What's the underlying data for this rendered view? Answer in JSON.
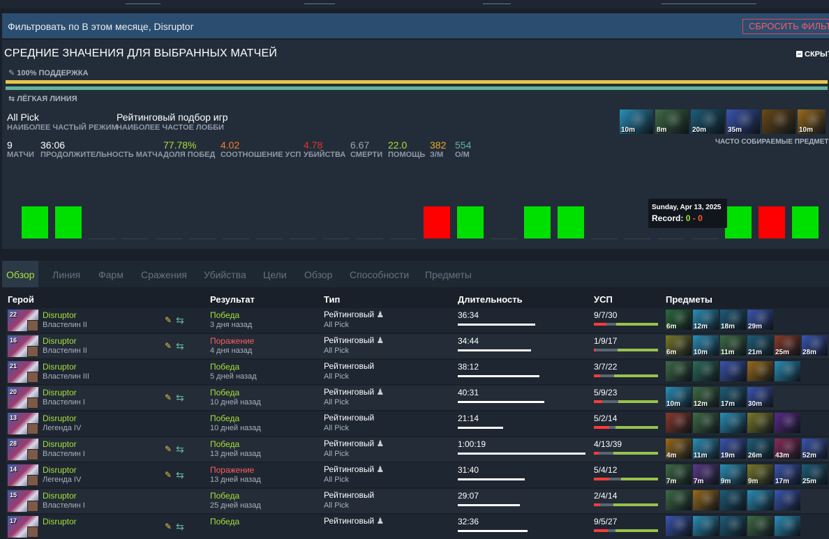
{
  "filter": {
    "text": "Фильтровать по В этом месяце, Disruptor",
    "reset_label": "СБРОСИТЬ ФИЛЬТР"
  },
  "averages": {
    "title": "СРЕДНИЕ ЗНАЧЕНИЯ ДЛЯ ВЫБРАННЫХ МАТЧЕЙ",
    "hide_label": "СКРЫТЬ",
    "support_label": "100% ПОДДЕРЖКА",
    "lane_label": "ЛЁГКАЯ ЛИНИЯ",
    "mode_value": "All Pick",
    "mode_label": "НАИБОЛЕЕ ЧАСТЫЙ РЕЖИМ",
    "lobby_value": "Рейтинговый подбор игр",
    "lobby_label": "НАИБОЛЕЕ ЧАСТОЕ ЛОББИ",
    "stats": [
      {
        "value": "9",
        "label": "МАТЧИ",
        "color": "#ffffff"
      },
      {
        "value": "36:06",
        "label": "ПРОДОЛЖИТЕЛЬНОСТЬ МАТЧА",
        "color": "#ffffff"
      },
      {
        "value": "77.78%",
        "label": "ДОЛЯ ПОБЕД",
        "color": "#a6e13b"
      },
      {
        "value": "4.02",
        "label": "СООТНОШЕНИЕ УСП",
        "color": "#ff7a2f"
      },
      {
        "value": "4.78",
        "label": "УБИЙСТВА",
        "color": "#e5312f"
      },
      {
        "value": "6.67",
        "label": "СМЕРТИ",
        "color": "#9aa3ad"
      },
      {
        "value": "22.0",
        "label": "ПОМОЩЬ",
        "color": "#a6e13b"
      },
      {
        "value": "382",
        "label": "З/М",
        "color": "#f0a828"
      },
      {
        "value": "554",
        "label": "О/М",
        "color": "#63b49a"
      }
    ],
    "fav_items": [
      {
        "time": "10m",
        "icon": "bottle-icon",
        "color": "#2a8fb8"
      },
      {
        "time": "8m",
        "icon": "wand-icon",
        "color": "#3f6b45"
      },
      {
        "time": "20m",
        "icon": "blink-icon",
        "color": "#1f5d79"
      },
      {
        "time": "35m",
        "icon": "scepter-icon",
        "color": "#3b55b0"
      },
      {
        "time": "",
        "icon": "box-icon",
        "color": "#6b4a18"
      },
      {
        "time": "10m",
        "icon": "staff-icon",
        "color": "#9a6a1c"
      }
    ],
    "fav_label": "ЧАСТО СОБИРАЕМЫЕ ПРЕДМЕТЫ",
    "streak": [
      "win",
      "win",
      "none",
      "none",
      "none",
      "none",
      "none",
      "none",
      "none",
      "none",
      "none",
      "none",
      "loss",
      "win",
      "none",
      "win",
      "win",
      "none",
      "none",
      "none",
      "none",
      "win",
      "loss",
      "win"
    ],
    "colors": {
      "win": "#00e000",
      "loss": "#ff0000"
    },
    "tooltip": {
      "date": "Sunday, Apr 13, 2025",
      "label": "Record:",
      "wins": "0",
      "sep": "-",
      "losses": "0"
    }
  },
  "tabs": [
    "Обзор",
    "Линия",
    "Фарм",
    "Сражения",
    "Убийства",
    "Цели",
    "Обзор",
    "Способности",
    "Предметы"
  ],
  "table": {
    "headers": {
      "hero": "Герой",
      "result": "Результат",
      "type": "Тип",
      "duration": "Длительность",
      "kda": "УСП",
      "items": "Предметы"
    },
    "rows": [
      {
        "level": "22",
        "hero": "Disruptor",
        "rank": "Властелин II",
        "icons": true,
        "result": "Победа",
        "win": true,
        "ago": "3 дня назад",
        "type": "Рейтинговый",
        "party": true,
        "mode": "All Pick",
        "duration": "36:34",
        "dur_frac": 0.6,
        "kda": "9/7/30",
        "k": 9,
        "d": 7,
        "a": 30,
        "items": [
          {
            "t": "6m",
            "c": "#2b6b3a"
          },
          {
            "t": "12m",
            "c": "#2a8fb8"
          },
          {
            "t": "18m",
            "c": "#1f5d79"
          },
          {
            "t": "29m",
            "c": "#3b55b0"
          }
        ]
      },
      {
        "level": "16",
        "hero": "Disruptor",
        "rank": "Властелин II",
        "icons": true,
        "result": "Поражение",
        "win": false,
        "ago": "4 дня назад",
        "type": "Рейтинговый",
        "party": true,
        "mode": "All Pick",
        "duration": "34:44",
        "dur_frac": 0.57,
        "kda": "1/9/17",
        "k": 1,
        "d": 9,
        "a": 17,
        "items": [
          {
            "t": "6m",
            "c": "#7a7a2a"
          },
          {
            "t": "10m",
            "c": "#2a8fb8"
          },
          {
            "t": "11m",
            "c": "#3f6b45"
          },
          {
            "t": "21m",
            "c": "#1f5d79"
          },
          {
            "t": "25m",
            "c": "#8a3a2a"
          },
          {
            "t": "28m",
            "c": "#3b55b0"
          }
        ]
      },
      {
        "level": "21",
        "hero": "Disruptor",
        "rank": "Властелин III",
        "icons": false,
        "result": "Победа",
        "win": true,
        "ago": "5 дней назад",
        "type": "Рейтинговый",
        "party": false,
        "mode": "All Pick",
        "duration": "38:12",
        "dur_frac": 0.63,
        "kda": "3/7/22",
        "k": 3,
        "d": 7,
        "a": 22,
        "items": [
          {
            "t": "",
            "c": "#3f6b45"
          },
          {
            "t": "",
            "c": "#2b6b5a"
          },
          {
            "t": "",
            "c": "#3b55b0"
          },
          {
            "t": "",
            "c": "#9a6a1c"
          },
          {
            "t": "",
            "c": "#2a8fb8"
          }
        ]
      },
      {
        "level": "20",
        "hero": "Disruptor",
        "rank": "Властелин I",
        "icons": true,
        "result": "Победа",
        "win": true,
        "ago": "10 дней назад",
        "type": "Рейтинговый",
        "party": true,
        "mode": "All Pick",
        "duration": "40:31",
        "dur_frac": 0.67,
        "kda": "5/9/23",
        "k": 5,
        "d": 9,
        "a": 23,
        "items": [
          {
            "t": "10m",
            "c": "#2a8fb8"
          },
          {
            "t": "12m",
            "c": "#3f6b45"
          },
          {
            "t": "17m",
            "c": "#1f5d79"
          },
          {
            "t": "30m",
            "c": "#3b55b0"
          }
        ]
      },
      {
        "level": "13",
        "hero": "Disruptor",
        "rank": "Легенда IV",
        "icons": false,
        "result": "Победа",
        "win": true,
        "ago": "10 дней назад",
        "type": "Рейтинговый",
        "party": false,
        "mode": "All Pick",
        "duration": "21:14",
        "dur_frac": 0.35,
        "kda": "5/2/14",
        "k": 5,
        "d": 2,
        "a": 14,
        "items": [
          {
            "t": "",
            "c": "#8a3a2a"
          },
          {
            "t": "",
            "c": "#3f6b45"
          },
          {
            "t": "",
            "c": "#2a8fb8"
          },
          {
            "t": "",
            "c": "#7a7a2a"
          },
          {
            "t": "",
            "c": "#5a2a8a"
          }
        ]
      },
      {
        "level": "28",
        "hero": "Disruptor",
        "rank": "Властелин I",
        "icons": true,
        "result": "Победа",
        "win": true,
        "ago": "13 дней назад",
        "type": "Рейтинговый",
        "party": true,
        "mode": "All Pick",
        "duration": "1:00:19",
        "dur_frac": 0.99,
        "kda": "4/13/39",
        "k": 4,
        "d": 13,
        "a": 39,
        "items": [
          {
            "t": "4m",
            "c": "#9a6a1c"
          },
          {
            "t": "11m",
            "c": "#2a8fb8"
          },
          {
            "t": "19m",
            "c": "#3b55b0"
          },
          {
            "t": "26m",
            "c": "#1f5d79"
          },
          {
            "t": "43m",
            "c": "#8a2a5a"
          },
          {
            "t": "52m",
            "c": "#3b55b0"
          }
        ]
      },
      {
        "level": "14",
        "hero": "Disruptor",
        "rank": "Легенда IV",
        "icons": true,
        "result": "Поражение",
        "win": false,
        "ago": "13 дней назад",
        "type": "Рейтинговый",
        "party": true,
        "mode": "All Pick",
        "duration": "31:40",
        "dur_frac": 0.52,
        "kda": "5/4/12",
        "k": 5,
        "d": 4,
        "a": 12,
        "items": [
          {
            "t": "7m",
            "c": "#3f6b45"
          },
          {
            "t": "7m",
            "c": "#5a3a8a"
          },
          {
            "t": "9m",
            "c": "#2a8fb8"
          },
          {
            "t": "9m",
            "c": "#7a7a2a"
          },
          {
            "t": "17m",
            "c": "#3b55b0"
          },
          {
            "t": "25m",
            "c": "#1f5d79"
          }
        ]
      },
      {
        "level": "15",
        "hero": "Disruptor",
        "rank": "Властелин I",
        "icons": false,
        "result": "Победа",
        "win": true,
        "ago": "25 дней назад",
        "type": "Рейтинговый",
        "party": false,
        "mode": "All Pick",
        "duration": "29:07",
        "dur_frac": 0.48,
        "kda": "2/4/14",
        "k": 2,
        "d": 4,
        "a": 14,
        "items": [
          {
            "t": "",
            "c": "#3f6b45"
          },
          {
            "t": "",
            "c": "#9a6a1c"
          },
          {
            "t": "",
            "c": "#1f5d79"
          },
          {
            "t": "",
            "c": "#2a8fb8"
          },
          {
            "t": "",
            "c": "#3b55b0"
          }
        ]
      },
      {
        "level": "17",
        "hero": "Disruptor",
        "rank": "",
        "icons": true,
        "result": "Победа",
        "win": true,
        "ago": "",
        "type": "Рейтинговый",
        "party": true,
        "mode": "",
        "duration": "32:36",
        "dur_frac": 0.54,
        "kda": "9/5/27",
        "k": 9,
        "d": 5,
        "a": 27,
        "items": [
          {
            "t": "",
            "c": "#3b55b0"
          },
          {
            "t": "",
            "c": "#2a8fb8"
          },
          {
            "t": "",
            "c": "#1f5d79"
          },
          {
            "t": "",
            "c": "#3f6b45"
          },
          {
            "t": "",
            "c": "#2a8fb8"
          }
        ]
      }
    ]
  }
}
